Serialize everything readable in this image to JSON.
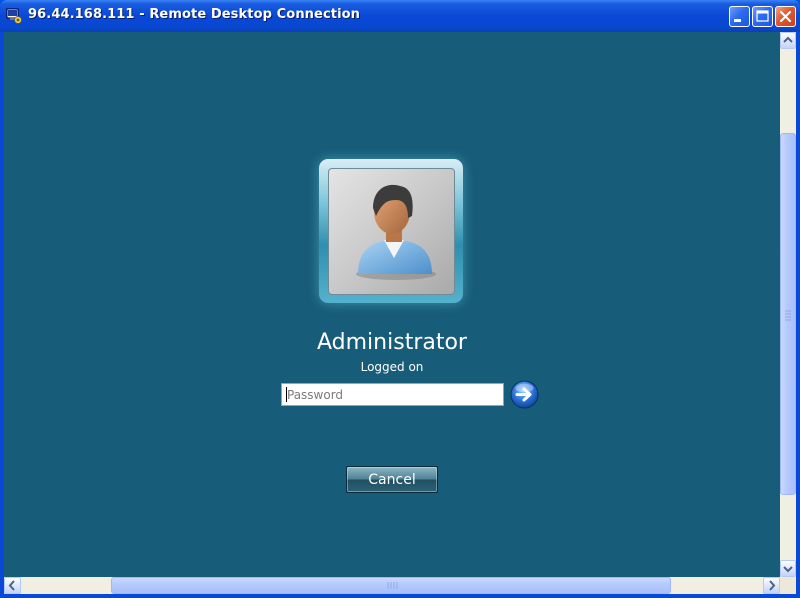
{
  "window": {
    "title": "96.44.168.111 - Remote Desktop Connection"
  },
  "login": {
    "username": "Administrator",
    "status": "Logged on",
    "password_placeholder": "Password",
    "password_value": "",
    "cancel_label": "Cancel"
  },
  "icons": {
    "app": "remote-desktop-icon",
    "minimize": "minimize-icon",
    "maximize": "maximize-icon",
    "close": "close-icon",
    "avatar": "user-avatar-icon",
    "submit": "arrow-right-icon"
  },
  "colors": {
    "desktop_background": "#175c79",
    "titlebar": "#0a48d6",
    "close_button": "#e0572f"
  }
}
